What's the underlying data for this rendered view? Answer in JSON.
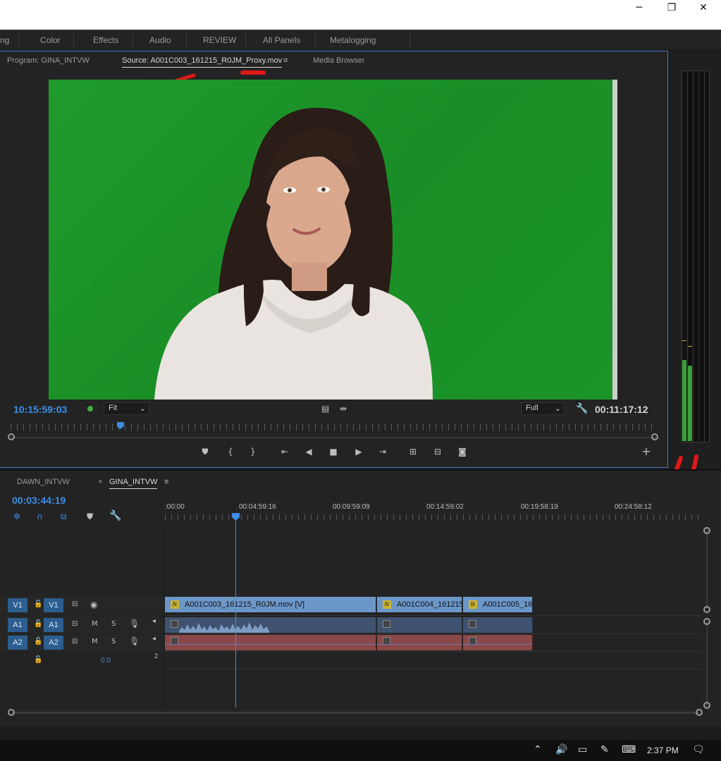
{
  "window": {
    "minimize": "─",
    "restore": "❐",
    "close": "✕"
  },
  "workspaces": [
    "ng",
    "Color",
    "Effects",
    "Audio",
    "REVIEW",
    "All Panels",
    "Metalogging"
  ],
  "monitor": {
    "tabs": {
      "program": "Program: GINA_INTVW",
      "source": "Source: A001C003_161215_R0JM_Proxy.mov",
      "media_browser": "Media Browser"
    },
    "timecode_in": "10:15:59:03",
    "zoom": "Fit",
    "resolution": "Full",
    "duration": "00:11:17:12",
    "playhead_fraction": 0.17
  },
  "timeline": {
    "tabs": {
      "dawn": "DAWN_INTVW",
      "gina": "GINA_INTVW",
      "close": "×"
    },
    "current_time": "00:03:44:19",
    "ruler": [
      ":00:00",
      "00:04:59:16",
      "00:09:59:09",
      "00:14:59:02",
      "00:19:58:19",
      "00:24:58:12"
    ],
    "tracks": {
      "v1": {
        "source": "V1",
        "target": "V1"
      },
      "a1": {
        "source": "A1",
        "target": "A1",
        "m": "M",
        "s": "S"
      },
      "a2": {
        "source": "A2",
        "target": "A2",
        "m": "M",
        "s": "S"
      },
      "master_volume": "0.0",
      "master_extra": "2"
    },
    "clips": {
      "v1": [
        "A001C003_161215_R0JM.mov [V]",
        "A001C004_161215",
        "A001C005_161"
      ]
    }
  },
  "taskbar": {
    "time": "2:37 PM"
  }
}
